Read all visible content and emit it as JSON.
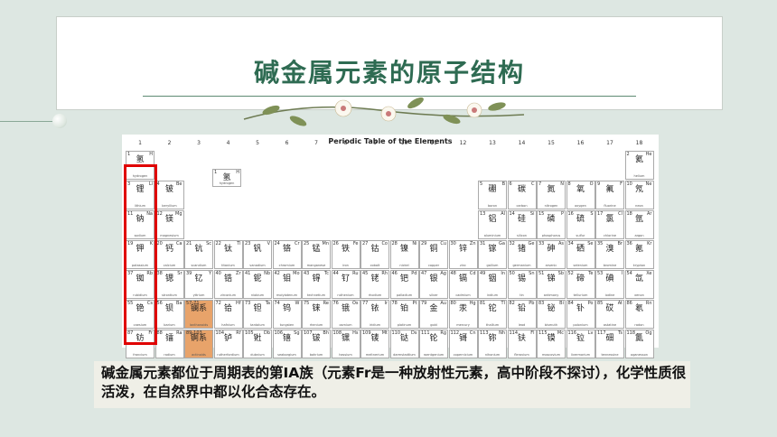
{
  "slide": {
    "title": "碱金属元素的原子结构",
    "caption": "碱金属元素都位于周期表的第ⅠA族（元素Fr是一种放射性元素，高中阶段不探讨），化学性质很活泼，在自然界中都以化合态存在。"
  },
  "periodic_table": {
    "title": "Periodic Table of the Elements",
    "group_labels": [
      "1",
      "2",
      "3",
      "4",
      "5",
      "6",
      "7",
      "8",
      "9",
      "10",
      "11",
      "12",
      "13",
      "14",
      "15",
      "16",
      "17",
      "18"
    ],
    "legend": {
      "number": "1",
      "symbol": "H",
      "name_cn": "氢",
      "name_en": "hydrogen"
    },
    "elements": [
      {
        "n": "1",
        "s": "H",
        "cn": "氢",
        "en": "hydrogen",
        "g": 1,
        "p": 1
      },
      {
        "n": "2",
        "s": "He",
        "cn": "氦",
        "en": "helium",
        "g": 18,
        "p": 1
      },
      {
        "n": "3",
        "s": "Li",
        "cn": "锂",
        "en": "lithium",
        "g": 1,
        "p": 2
      },
      {
        "n": "4",
        "s": "Be",
        "cn": "铍",
        "en": "beryllium",
        "g": 2,
        "p": 2
      },
      {
        "n": "5",
        "s": "B",
        "cn": "硼",
        "en": "boron",
        "g": 13,
        "p": 2
      },
      {
        "n": "6",
        "s": "C",
        "cn": "碳",
        "en": "carbon",
        "g": 14,
        "p": 2
      },
      {
        "n": "7",
        "s": "N",
        "cn": "氮",
        "en": "nitrogen",
        "g": 15,
        "p": 2
      },
      {
        "n": "8",
        "s": "O",
        "cn": "氧",
        "en": "oxygen",
        "g": 16,
        "p": 2
      },
      {
        "n": "9",
        "s": "F",
        "cn": "氟",
        "en": "fluorine",
        "g": 17,
        "p": 2
      },
      {
        "n": "10",
        "s": "Ne",
        "cn": "氖",
        "en": "neon",
        "g": 18,
        "p": 2
      },
      {
        "n": "11",
        "s": "Na",
        "cn": "钠",
        "en": "sodium",
        "g": 1,
        "p": 3
      },
      {
        "n": "12",
        "s": "Mg",
        "cn": "镁",
        "en": "magnesium",
        "g": 2,
        "p": 3
      },
      {
        "n": "13",
        "s": "Al",
        "cn": "铝",
        "en": "aluminium",
        "g": 13,
        "p": 3
      },
      {
        "n": "14",
        "s": "Si",
        "cn": "硅",
        "en": "silicon",
        "g": 14,
        "p": 3
      },
      {
        "n": "15",
        "s": "P",
        "cn": "磷",
        "en": "phosphorus",
        "g": 15,
        "p": 3
      },
      {
        "n": "16",
        "s": "S",
        "cn": "硫",
        "en": "sulfur",
        "g": 16,
        "p": 3
      },
      {
        "n": "17",
        "s": "Cl",
        "cn": "氯",
        "en": "chlorine",
        "g": 17,
        "p": 3
      },
      {
        "n": "18",
        "s": "Ar",
        "cn": "氩",
        "en": "argon",
        "g": 18,
        "p": 3
      },
      {
        "n": "19",
        "s": "K",
        "cn": "钾",
        "en": "potassium",
        "g": 1,
        "p": 4
      },
      {
        "n": "20",
        "s": "Ca",
        "cn": "钙",
        "en": "calcium",
        "g": 2,
        "p": 4
      },
      {
        "n": "21",
        "s": "Sc",
        "cn": "钪",
        "en": "scandium",
        "g": 3,
        "p": 4
      },
      {
        "n": "22",
        "s": "Ti",
        "cn": "钛",
        "en": "titanium",
        "g": 4,
        "p": 4
      },
      {
        "n": "23",
        "s": "V",
        "cn": "钒",
        "en": "vanadium",
        "g": 5,
        "p": 4
      },
      {
        "n": "24",
        "s": "Cr",
        "cn": "铬",
        "en": "chromium",
        "g": 6,
        "p": 4
      },
      {
        "n": "25",
        "s": "Mn",
        "cn": "锰",
        "en": "manganese",
        "g": 7,
        "p": 4
      },
      {
        "n": "26",
        "s": "Fe",
        "cn": "铁",
        "en": "iron",
        "g": 8,
        "p": 4
      },
      {
        "n": "27",
        "s": "Co",
        "cn": "钴",
        "en": "cobalt",
        "g": 9,
        "p": 4
      },
      {
        "n": "28",
        "s": "Ni",
        "cn": "镍",
        "en": "nickel",
        "g": 10,
        "p": 4
      },
      {
        "n": "29",
        "s": "Cu",
        "cn": "铜",
        "en": "copper",
        "g": 11,
        "p": 4
      },
      {
        "n": "30",
        "s": "Zn",
        "cn": "锌",
        "en": "zinc",
        "g": 12,
        "p": 4
      },
      {
        "n": "31",
        "s": "Ga",
        "cn": "镓",
        "en": "gallium",
        "g": 13,
        "p": 4
      },
      {
        "n": "32",
        "s": "Ge",
        "cn": "锗",
        "en": "germanium",
        "g": 14,
        "p": 4
      },
      {
        "n": "33",
        "s": "As",
        "cn": "砷",
        "en": "arsenic",
        "g": 15,
        "p": 4
      },
      {
        "n": "34",
        "s": "Se",
        "cn": "硒",
        "en": "selenium",
        "g": 16,
        "p": 4
      },
      {
        "n": "35",
        "s": "Br",
        "cn": "溴",
        "en": "bromine",
        "g": 17,
        "p": 4
      },
      {
        "n": "36",
        "s": "Kr",
        "cn": "氪",
        "en": "krypton",
        "g": 18,
        "p": 4
      },
      {
        "n": "37",
        "s": "Rb",
        "cn": "铷",
        "en": "rubidium",
        "g": 1,
        "p": 5
      },
      {
        "n": "38",
        "s": "Sr",
        "cn": "锶",
        "en": "strontium",
        "g": 2,
        "p": 5
      },
      {
        "n": "39",
        "s": "Y",
        "cn": "钇",
        "en": "yttrium",
        "g": 3,
        "p": 5
      },
      {
        "n": "40",
        "s": "Zr",
        "cn": "锆",
        "en": "zirconium",
        "g": 4,
        "p": 5
      },
      {
        "n": "41",
        "s": "Nb",
        "cn": "铌",
        "en": "niobium",
        "g": 5,
        "p": 5
      },
      {
        "n": "42",
        "s": "Mo",
        "cn": "钼",
        "en": "molybdenum",
        "g": 6,
        "p": 5
      },
      {
        "n": "43",
        "s": "Tc",
        "cn": "锝",
        "en": "technetium",
        "g": 7,
        "p": 5
      },
      {
        "n": "44",
        "s": "Ru",
        "cn": "钌",
        "en": "ruthenium",
        "g": 8,
        "p": 5
      },
      {
        "n": "45",
        "s": "Rh",
        "cn": "铑",
        "en": "rhodium",
        "g": 9,
        "p": 5
      },
      {
        "n": "46",
        "s": "Pd",
        "cn": "钯",
        "en": "palladium",
        "g": 10,
        "p": 5
      },
      {
        "n": "47",
        "s": "Ag",
        "cn": "银",
        "en": "silver",
        "g": 11,
        "p": 5
      },
      {
        "n": "48",
        "s": "Cd",
        "cn": "镉",
        "en": "cadmium",
        "g": 12,
        "p": 5
      },
      {
        "n": "49",
        "s": "In",
        "cn": "铟",
        "en": "indium",
        "g": 13,
        "p": 5
      },
      {
        "n": "50",
        "s": "Sn",
        "cn": "锡",
        "en": "tin",
        "g": 14,
        "p": 5
      },
      {
        "n": "51",
        "s": "Sb",
        "cn": "锑",
        "en": "antimony",
        "g": 15,
        "p": 5
      },
      {
        "n": "52",
        "s": "Te",
        "cn": "碲",
        "en": "tellurium",
        "g": 16,
        "p": 5
      },
      {
        "n": "53",
        "s": "I",
        "cn": "碘",
        "en": "iodine",
        "g": 17,
        "p": 5
      },
      {
        "n": "54",
        "s": "Xe",
        "cn": "氙",
        "en": "xenon",
        "g": 18,
        "p": 5
      },
      {
        "n": "55",
        "s": "Cs",
        "cn": "铯",
        "en": "caesium",
        "g": 1,
        "p": 6
      },
      {
        "n": "56",
        "s": "Ba",
        "cn": "钡",
        "en": "barium",
        "g": 2,
        "p": 6
      },
      {
        "n": "57-71",
        "s": "",
        "cn": "镧系",
        "en": "lanthanoids",
        "g": 3,
        "p": 6,
        "lan": true
      },
      {
        "n": "72",
        "s": "Hf",
        "cn": "铪",
        "en": "hafnium",
        "g": 4,
        "p": 6
      },
      {
        "n": "73",
        "s": "Ta",
        "cn": "钽",
        "en": "tantalum",
        "g": 5,
        "p": 6
      },
      {
        "n": "74",
        "s": "W",
        "cn": "钨",
        "en": "tungsten",
        "g": 6,
        "p": 6
      },
      {
        "n": "75",
        "s": "Re",
        "cn": "铼",
        "en": "rhenium",
        "g": 7,
        "p": 6
      },
      {
        "n": "76",
        "s": "Os",
        "cn": "锇",
        "en": "osmium",
        "g": 8,
        "p": 6
      },
      {
        "n": "77",
        "s": "Ir",
        "cn": "铱",
        "en": "iridium",
        "g": 9,
        "p": 6
      },
      {
        "n": "78",
        "s": "Pt",
        "cn": "铂",
        "en": "platinum",
        "g": 10,
        "p": 6
      },
      {
        "n": "79",
        "s": "Au",
        "cn": "金",
        "en": "gold",
        "g": 11,
        "p": 6
      },
      {
        "n": "80",
        "s": "Hg",
        "cn": "汞",
        "en": "mercury",
        "g": 12,
        "p": 6
      },
      {
        "n": "81",
        "s": "Tl",
        "cn": "铊",
        "en": "thallium",
        "g": 13,
        "p": 6
      },
      {
        "n": "82",
        "s": "Pb",
        "cn": "铅",
        "en": "lead",
        "g": 14,
        "p": 6
      },
      {
        "n": "83",
        "s": "Bi",
        "cn": "铋",
        "en": "bismuth",
        "g": 15,
        "p": 6
      },
      {
        "n": "84",
        "s": "Po",
        "cn": "钋",
        "en": "polonium",
        "g": 16,
        "p": 6
      },
      {
        "n": "85",
        "s": "At",
        "cn": "砹",
        "en": "astatine",
        "g": 17,
        "p": 6
      },
      {
        "n": "86",
        "s": "Rn",
        "cn": "氡",
        "en": "radon",
        "g": 18,
        "p": 6
      },
      {
        "n": "87",
        "s": "Fr",
        "cn": "钫",
        "en": "francium",
        "g": 1,
        "p": 7
      },
      {
        "n": "88",
        "s": "Ra",
        "cn": "镭",
        "en": "radium",
        "g": 2,
        "p": 7
      },
      {
        "n": "89-103",
        "s": "",
        "cn": "锕系",
        "en": "actinoids",
        "g": 3,
        "p": 7,
        "lan": true
      },
      {
        "n": "104",
        "s": "Rf",
        "cn": "𬬻",
        "en": "rutherfordium",
        "g": 4,
        "p": 7
      },
      {
        "n": "105",
        "s": "Db",
        "cn": "𬭊",
        "en": "dubnium",
        "g": 5,
        "p": 7
      },
      {
        "n": "106",
        "s": "Sg",
        "cn": "𬭳",
        "en": "seaborgium",
        "g": 6,
        "p": 7
      },
      {
        "n": "107",
        "s": "Bh",
        "cn": "𬭛",
        "en": "bohrium",
        "g": 7,
        "p": 7
      },
      {
        "n": "108",
        "s": "Hs",
        "cn": "𬭶",
        "en": "hassium",
        "g": 8,
        "p": 7
      },
      {
        "n": "109",
        "s": "Mt",
        "cn": "鿏",
        "en": "meitnerium",
        "g": 9,
        "p": 7
      },
      {
        "n": "110",
        "s": "Ds",
        "cn": "𫟼",
        "en": "darmstadtium",
        "g": 10,
        "p": 7
      },
      {
        "n": "111",
        "s": "Rg",
        "cn": "𬬭",
        "en": "roentgenium",
        "g": 11,
        "p": 7
      },
      {
        "n": "112",
        "s": "Cn",
        "cn": "鿔",
        "en": "copernicium",
        "g": 12,
        "p": 7
      },
      {
        "n": "113",
        "s": "Nh",
        "cn": "鿭",
        "en": "nihonium",
        "g": 13,
        "p": 7
      },
      {
        "n": "114",
        "s": "Fl",
        "cn": "𫓧",
        "en": "flerovium",
        "g": 14,
        "p": 7
      },
      {
        "n": "115",
        "s": "Mc",
        "cn": "镆",
        "en": "moscovium",
        "g": 15,
        "p": 7
      },
      {
        "n": "116",
        "s": "Lv",
        "cn": "𫟷",
        "en": "livermorium",
        "g": 16,
        "p": 7
      },
      {
        "n": "117",
        "s": "Ts",
        "cn": "鿬",
        "en": "tennessine",
        "g": 17,
        "p": 7
      },
      {
        "n": "118",
        "s": "Og",
        "cn": "鿫",
        "en": "oganesson",
        "g": 18,
        "p": 7
      }
    ]
  }
}
